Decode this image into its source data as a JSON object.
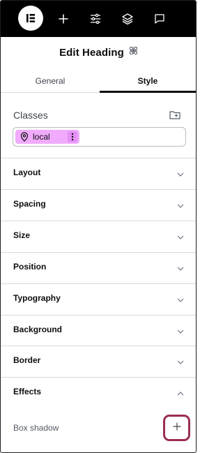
{
  "toolbar": {
    "logo_icon": "elementor-logo-icon",
    "icons": [
      "plus-icon",
      "sliders-icon",
      "layers-icon",
      "comment-icon"
    ]
  },
  "panel": {
    "title": "Edit Heading",
    "title_icon": "atomic-element-icon"
  },
  "tabs": [
    {
      "label": "General",
      "active": false
    },
    {
      "label": "Style",
      "active": true
    }
  ],
  "classes": {
    "label": "Classes",
    "icon": "folder-plus-icon",
    "chip": {
      "label": "local",
      "icon": "map-pin-icon",
      "color": "#f0abfc"
    }
  },
  "sections": [
    {
      "label": "Layout",
      "expanded": false
    },
    {
      "label": "Spacing",
      "expanded": false
    },
    {
      "label": "Size",
      "expanded": false
    },
    {
      "label": "Position",
      "expanded": false
    },
    {
      "label": "Typography",
      "expanded": false
    },
    {
      "label": "Background",
      "expanded": false
    },
    {
      "label": "Border",
      "expanded": false
    },
    {
      "label": "Effects",
      "expanded": true
    }
  ],
  "effects": {
    "box_shadow_label": "Box shadow",
    "add_icon": "plus-icon",
    "highlight_color": "#9b2c55"
  }
}
